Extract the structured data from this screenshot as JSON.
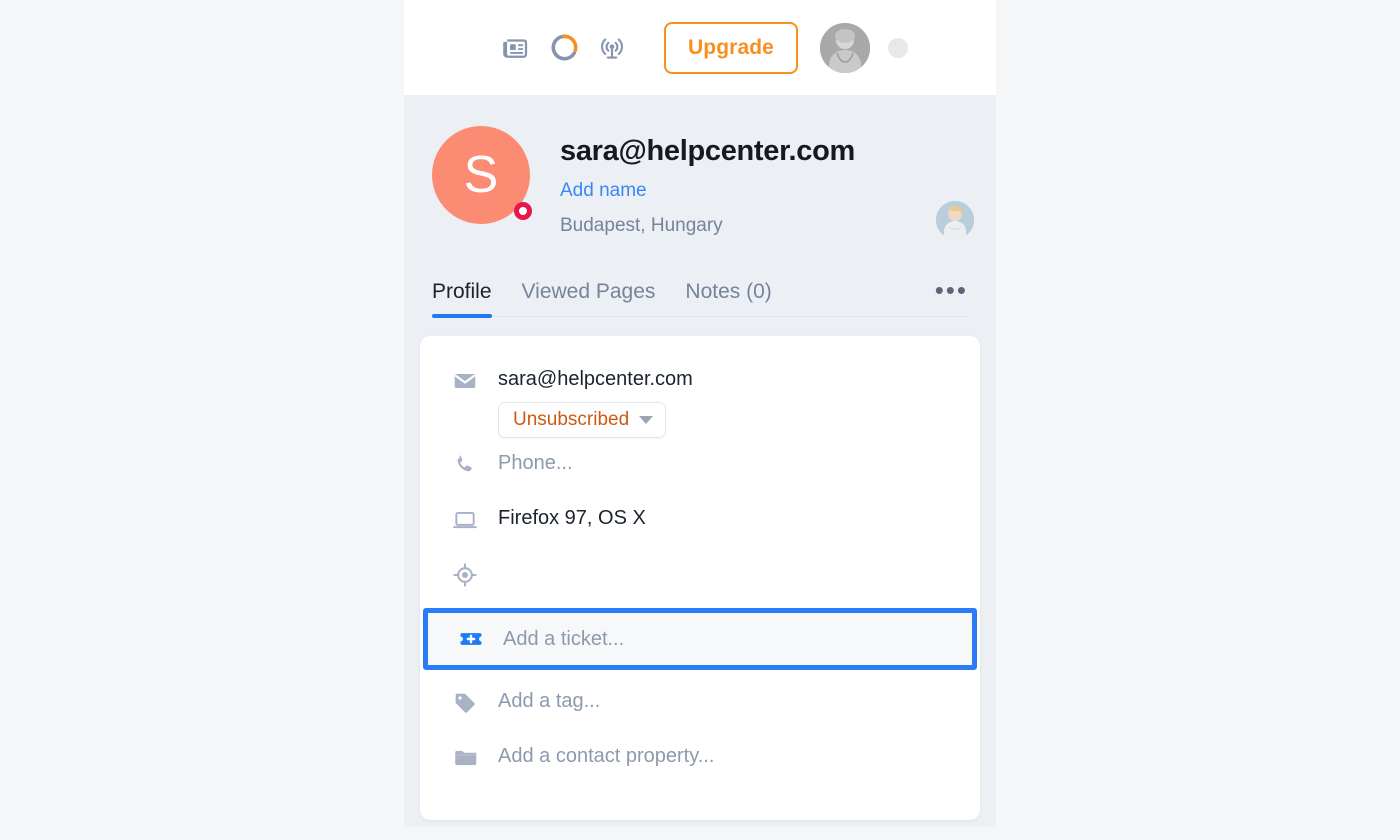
{
  "topbar": {
    "icons": [
      {
        "name": "news-icon",
        "label": "News"
      },
      {
        "name": "progress-ring-icon",
        "label": "Setup progress"
      },
      {
        "name": "broadcast-icon",
        "label": "Broadcast"
      }
    ],
    "upgrade_label": "Upgrade",
    "avatar_name": "account-avatar",
    "dot_name": "status-dot"
  },
  "profile": {
    "avatar_initial": "S",
    "email": "sara@helpcenter.com",
    "add_name_label": "Add name",
    "location": "Budapest, Hungary",
    "status_ring_color": "#e8174a",
    "avatar_color": "#fb8b72"
  },
  "tabs": {
    "items": [
      {
        "label": "Profile",
        "active": true
      },
      {
        "label": "Viewed Pages",
        "active": false
      },
      {
        "label": "Notes (0)",
        "active": false
      }
    ],
    "more_label": "•••"
  },
  "details": {
    "email": {
      "value": "sara@helpcenter.com",
      "badge_label": "Unsubscribed",
      "badge_color": "#cc5a12"
    },
    "phone_placeholder": "Phone...",
    "device": "Firefox 97, OS X",
    "location_value": "",
    "ticket_placeholder": "Add a ticket...",
    "tag_placeholder": "Add a tag...",
    "property_placeholder": "Add a contact property...",
    "highlight_color": "#2b7cf6"
  }
}
